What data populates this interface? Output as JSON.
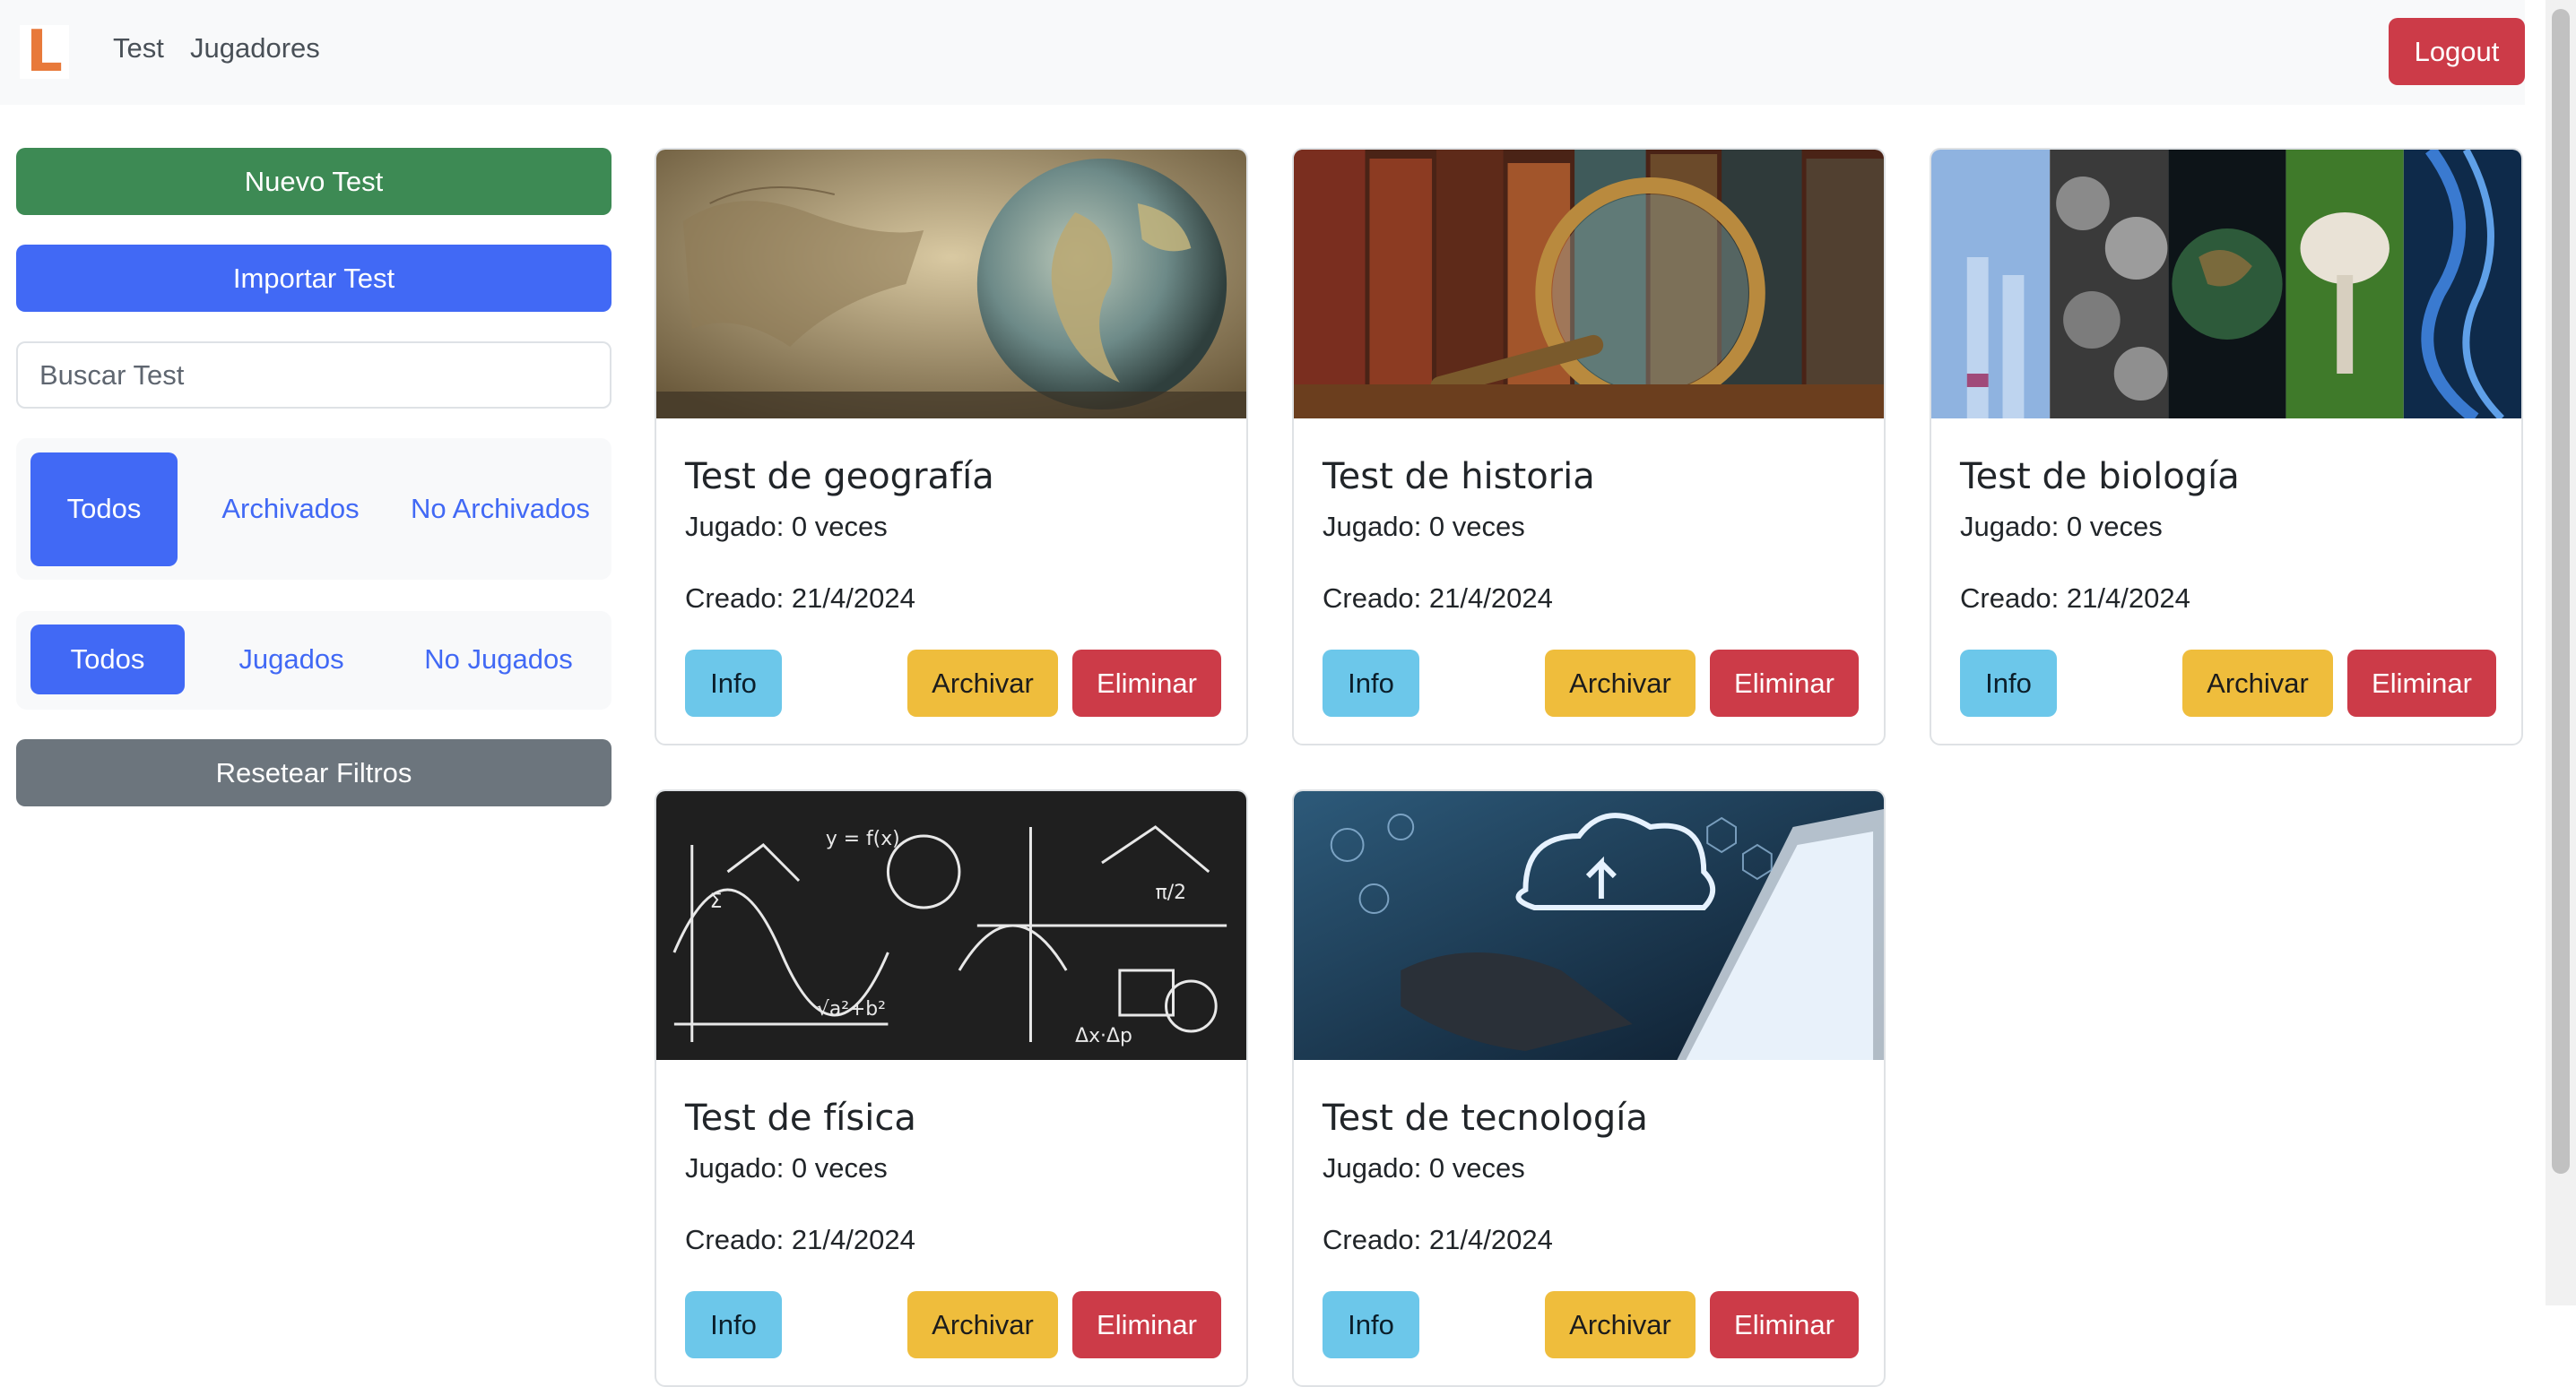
{
  "navbar": {
    "logo_letter": "L",
    "links": [
      "Test",
      "Jugadores"
    ],
    "logout_label": "Logout"
  },
  "sidebar": {
    "new_test_label": "Nuevo Test",
    "import_test_label": "Importar Test",
    "search_placeholder": "Buscar Test",
    "archive_filter": {
      "options": [
        "Todos",
        "Archivados",
        "No Archivados"
      ],
      "selected": "Todos"
    },
    "played_filter": {
      "options": [
        "Todos",
        "Jugados",
        "No Jugados"
      ],
      "selected": "Todos"
    },
    "reset_label": "Resetear Filtros"
  },
  "card_labels": {
    "info": "Info",
    "archive": "Archivar",
    "delete": "Eliminar"
  },
  "cards": [
    {
      "title": "Test de geografía",
      "played": "Jugado: 0 veces",
      "created": "Creado: 21/4/2024",
      "image": "globe-and-map"
    },
    {
      "title": "Test de historia",
      "played": "Jugado: 0 veces",
      "created": "Creado: 21/4/2024",
      "image": "magnifier-old-books"
    },
    {
      "title": "Test de biología",
      "played": "Jugado: 0 veces",
      "created": "Creado: 21/4/2024",
      "image": "biology-collage"
    },
    {
      "title": "Test de física",
      "played": "Jugado: 0 veces",
      "created": "Creado: 21/4/2024",
      "image": "chalkboard-equations"
    },
    {
      "title": "Test de tecnología",
      "played": "Jugado: 0 veces",
      "created": "Creado: 21/4/2024",
      "image": "cloud-laptop"
    }
  ],
  "colors": {
    "primary": "#4169f5",
    "success": "#3d8a54",
    "danger": "#cc3b48",
    "secondary": "#6c757d",
    "info": "#6cc7ea",
    "warning": "#efbd3c",
    "logo": "#e8793a"
  }
}
